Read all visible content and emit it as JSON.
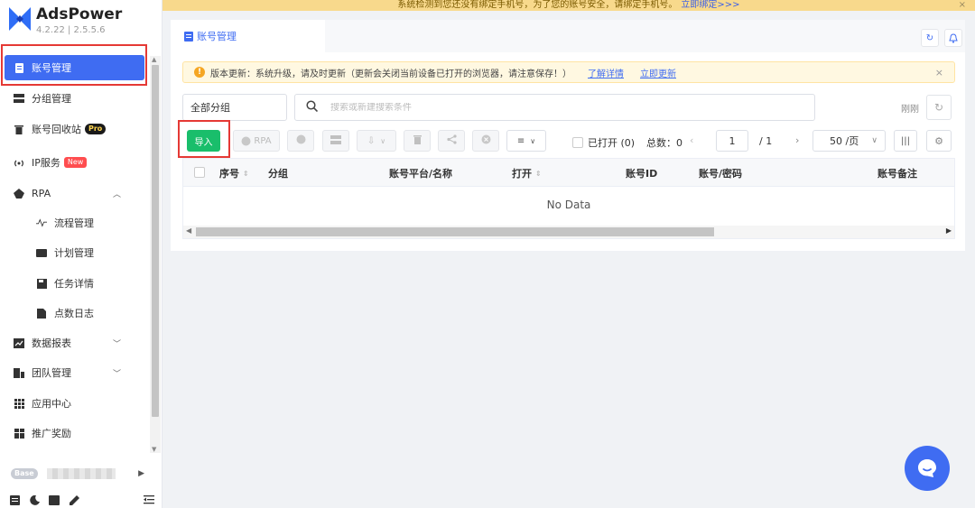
{
  "banner": {
    "text": "系统检测到您还没有绑定手机号，为了您的账号安全，请绑定手机号。",
    "link": "立即绑定>>>",
    "close": "×"
  },
  "app": {
    "name": "AdsPower",
    "version": "4.2.22 | 2.5.5.6"
  },
  "sidebar": {
    "items": [
      {
        "label": "账号管理"
      },
      {
        "label": "分组管理"
      },
      {
        "label": "账号回收站",
        "badge": "Pro"
      },
      {
        "label": "IP服务",
        "badge": "New"
      },
      {
        "label": "RPA"
      },
      {
        "label": "流程管理"
      },
      {
        "label": "计划管理"
      },
      {
        "label": "任务详情"
      },
      {
        "label": "点数日志"
      },
      {
        "label": "数据报表"
      },
      {
        "label": "团队管理"
      },
      {
        "label": "应用中心"
      },
      {
        "label": "推广奖励"
      }
    ],
    "plan_badge": "Base"
  },
  "tab": {
    "label": "账号管理"
  },
  "update": {
    "text": "版本更新：系统升级，请及时更新（更新会关闭当前设备已打开的浏览器，请注意保存！）",
    "learn_more": "了解详情",
    "update_now": "立即更新",
    "close": "×"
  },
  "filters": {
    "group": "全部分组",
    "search_placeholder": "搜索或新建搜索条件",
    "refresh_label": "刚刚"
  },
  "toolbar": {
    "import": "导入",
    "rpa": "RPA",
    "opened": "已打开 (0)",
    "total": "总数：0",
    "page": "1",
    "page_of": "/ 1",
    "page_size": "50 /页"
  },
  "table": {
    "columns": [
      "序号",
      "分组",
      "账号平台/名称",
      "打开",
      "账号ID",
      "账号/密码",
      "账号备注"
    ],
    "empty": "No Data"
  },
  "colors": {
    "accent": "#3f6cf2",
    "success": "#19be6b",
    "highlight": "#e53935",
    "warning": "#f5a623"
  }
}
